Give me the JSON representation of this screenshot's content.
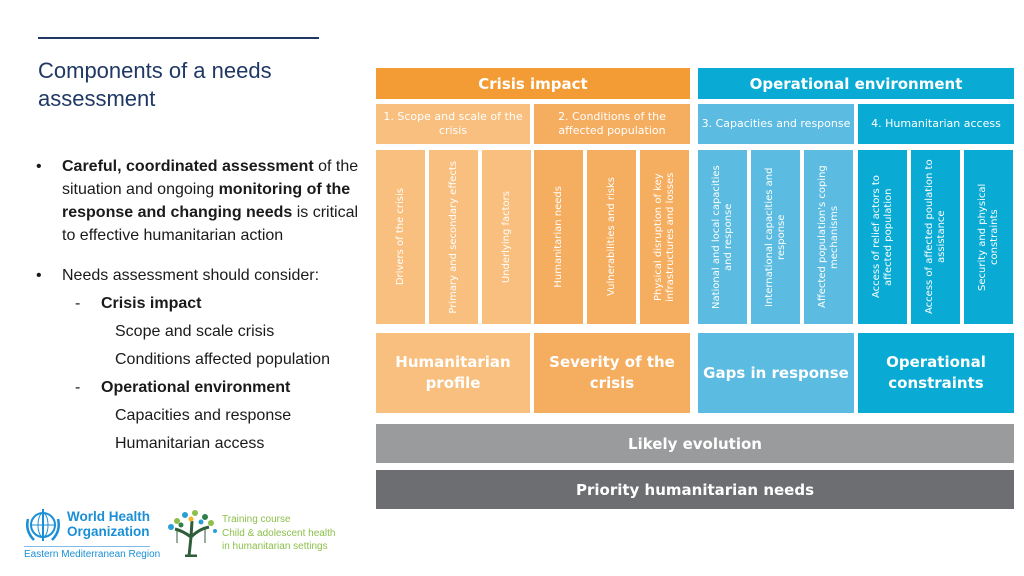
{
  "slide": {
    "title": "Components of a needs assessment",
    "bullets": {
      "first": {
        "bold1": "Careful, coordinated assessment",
        "text1": " of the situation and ongoing ",
        "bold2": "monitoring of the response and changing needs",
        "text2": " is critical to effective humanitarian action"
      },
      "second": {
        "text": "Needs assessment should consider:",
        "groups": [
          {
            "label": "Crisis impact",
            "items": [
              "Scope and scale crisis",
              "Conditions affected population"
            ]
          },
          {
            "label": "Operational environment",
            "items": [
              "Capacities and response",
              "Humanitarian access"
            ]
          }
        ]
      }
    }
  },
  "diagram": {
    "colors": {
      "orange_dark": "#f39c35",
      "orange_mid": "#f5ad5f",
      "orange_light": "#f8bf7e",
      "blue_light": "#5bbbe0",
      "blue_dark": "#09aad4",
      "gray_light": "#9a9b9d",
      "gray_dark": "#6d6e71"
    },
    "headers": [
      "Crisis impact",
      "Operational environment"
    ],
    "subheaders": [
      "1. Scope and scale of the crisis",
      "2. Conditions of the affected population",
      "3. Capacities and response",
      "4. Humanitarian access"
    ],
    "columns": [
      "Drivers of the crisis",
      "Primary and secondary effects",
      "Underlying factors",
      "Humanitarian  needs",
      "Vulnerabilities and risks",
      "Physical disruption of key infrastructures and losses",
      "National and local capacities and response",
      "International capacities and response",
      "Affected population's coping mechanisms",
      "Access of relief actors to affected population",
      "Access of affected poulation to assistance",
      "Security and physical constraints"
    ],
    "outcomes": [
      "Humanitarian profile",
      "Severity of the crisis",
      "Gaps in response",
      "Operational constraints"
    ],
    "likely_evolution": "Likely evolution",
    "priority_needs": "Priority humanitarian needs"
  },
  "footer": {
    "who_name_line1": "World Health",
    "who_name_line2": "Organization",
    "who_region": "Eastern Mediterranean Region",
    "course_line1": "Training course",
    "course_line2": "Child & adolescent health",
    "course_line3": "in humanitarian settings"
  }
}
